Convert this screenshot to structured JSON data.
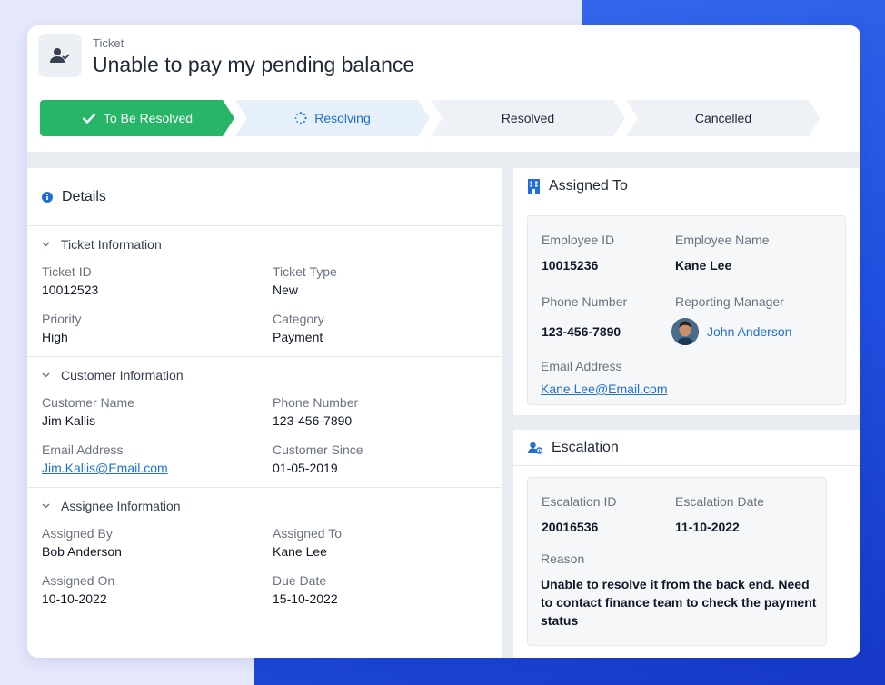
{
  "header": {
    "label": "Ticket",
    "title": "Unable to pay my pending balance",
    "icon": "user-check-icon"
  },
  "steps": [
    {
      "label": "To Be Resolved",
      "state": "done"
    },
    {
      "label": "Resolving",
      "state": "in-progress"
    },
    {
      "label": "Resolved",
      "state": "todo"
    },
    {
      "label": "Cancelled",
      "state": "todo"
    }
  ],
  "details": {
    "title": "Details",
    "ticket": {
      "heading": "Ticket Information",
      "ticket_id_label": "Ticket ID",
      "ticket_id": "10012523",
      "ticket_type_label": "Ticket Type",
      "ticket_type": "New",
      "priority_label": "Priority",
      "priority": "High",
      "category_label": "Category",
      "category": "Payment"
    },
    "customer": {
      "heading": "Customer Information",
      "name_label": "Customer Name",
      "name": "Jim Kallis",
      "phone_label": "Phone Number",
      "phone": "123-456-7890",
      "email_label": "Email Address",
      "email": "Jim.Kallis@Email.com",
      "since_label": "Customer Since",
      "since": "01-05-2019"
    },
    "assignee": {
      "heading": "Assignee Information",
      "by_label": "Assigned By",
      "by": "Bob Anderson",
      "to_label": "Assigned To",
      "to": "Kane Lee",
      "on_label": "Assigned On",
      "on": "10-10-2022",
      "due_label": "Due Date",
      "due": "15-10-2022"
    }
  },
  "assigned_to": {
    "title": "Assigned To",
    "emp_id_label": "Employee ID",
    "emp_id": "10015236",
    "emp_name_label": "Employee Name",
    "emp_name": "Kane Lee",
    "phone_label": "Phone Number",
    "phone": "123-456-7890",
    "manager_label": "Reporting Manager",
    "manager": "John Anderson",
    "email_label": "Email Address",
    "email": "Kane.Lee@Email.com"
  },
  "escalation": {
    "title": "Escalation",
    "esc_id_label": "Escalation ID",
    "esc_id": "20016536",
    "esc_date_label": "Escalation Date",
    "esc_date": "11-10-2022",
    "reason_label": "Reason",
    "reason": "Unable to resolve it from the back end. Need to contact finance team to check the payment status"
  },
  "colors": {
    "accent": "#1f6fd6",
    "success": "#27b567",
    "background_gradient": "#2150e0"
  }
}
